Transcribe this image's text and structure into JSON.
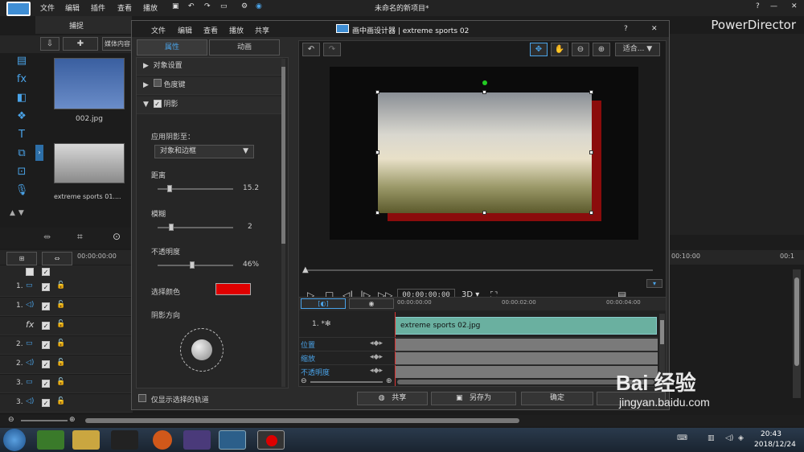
{
  "menubar": {
    "items": [
      "文件",
      "编辑",
      "插件",
      "查看",
      "播放"
    ],
    "title": "未命名的新项目*",
    "help": "?",
    "minimize": "—",
    "maximize": "□",
    "close": "✕",
    "brand": "PowerDirector"
  },
  "library": {
    "capture_tab": "捕捉",
    "media_tab": "媒体内容",
    "items": [
      {
        "label": "002.jpg"
      },
      {
        "label": "extreme sports 01...."
      }
    ]
  },
  "tracks": [
    {
      "num": "1.",
      "type": "video"
    },
    {
      "num": "1.",
      "type": "audio"
    },
    {
      "num": "",
      "type": "fx"
    },
    {
      "num": "2.",
      "type": "video"
    },
    {
      "num": "2.",
      "type": "audio"
    },
    {
      "num": "3.",
      "type": "video"
    },
    {
      "num": "3.",
      "type": "audio"
    }
  ],
  "ruler": {
    "t0": "00:00:00:00",
    "t_end": "00:10:00",
    "t_far": "00:1"
  },
  "dialog": {
    "menu": [
      "文件",
      "编辑",
      "查看",
      "播放",
      "共享"
    ],
    "title": "画中画设计器 | extreme sports 02",
    "help": "?",
    "close": "✕",
    "tabs": [
      "属性",
      "动画"
    ],
    "sections": [
      "对象设置",
      "色度键",
      "阴影"
    ],
    "shadow": {
      "apply_label": "应用阴影至：",
      "apply_value": "对象和边框",
      "distance_label": "距离",
      "distance_value": "15.2",
      "distance_fraction": 0.22,
      "blur_label": "模糊",
      "blur_value": "2",
      "blur_fraction": 0.18,
      "opacity_label": "不透明度",
      "opacity_value": "46%",
      "opacity_fraction": 0.46,
      "color_label": "选择颜色",
      "color": "#e00000",
      "direction_label": "阴影方向"
    },
    "only_selected_label": "仅显示选择的轨道",
    "fit_label": "适合...",
    "timecode": "00:00:00:00",
    "mode_3d": "3D",
    "timeline": {
      "t0": "00:00:00:00",
      "t1": "00:00:02:00",
      "t2": "00:00:04:00",
      "track_label": "1.",
      "clip": "extreme sports 02.jpg",
      "rows": [
        "位置",
        "缩放",
        "不透明度"
      ]
    },
    "buttons": {
      "share": "共享",
      "save_as": "另存为",
      "ok": "确定"
    }
  },
  "taskbar": {
    "time": "20:43",
    "date": "2018/12/24"
  },
  "watermark": {
    "brand": "Bai 经验",
    "url": "jingyan.baidu.com"
  }
}
